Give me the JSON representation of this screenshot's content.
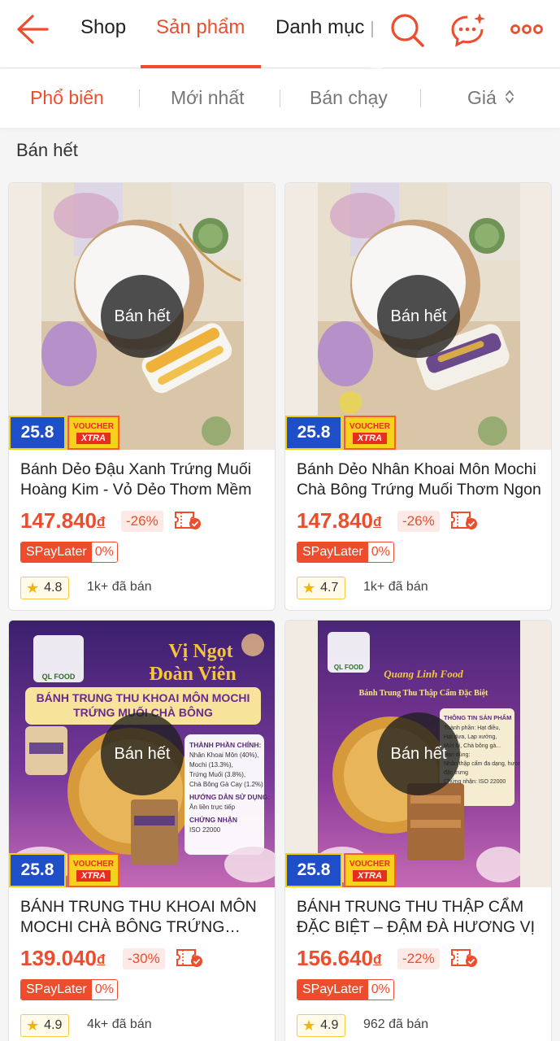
{
  "header": {
    "tabs": [
      {
        "label": "Shop"
      },
      {
        "label": "Sản phẩm"
      },
      {
        "label": "Danh mục"
      }
    ]
  },
  "sort": {
    "items": [
      {
        "label": "Phổ biến"
      },
      {
        "label": "Mới nhất"
      },
      {
        "label": "Bán chạy"
      },
      {
        "label": "Giá"
      }
    ]
  },
  "section": {
    "title": "Bán hết"
  },
  "colors": {
    "accent": "#ee4d2d"
  },
  "products": [
    {
      "name": "Bánh Dẻo Đậu Xanh Trứng Muối Hoàng Kim - Vỏ Dẻo Thơm Mềm",
      "price": "147.840",
      "currency": "đ",
      "discount": "-26%",
      "soldout": "Bán hết",
      "badge_event": "25.8",
      "badge_voucher_top": "VOUCHER",
      "badge_voucher_bottom": "XTRA",
      "spaylater": "SPayLater",
      "spaylater_rate": "0%",
      "rating": "4.8",
      "sold": "1k+ đã bán"
    },
    {
      "name": "Bánh Dẻo Nhân Khoai Môn Mochi Chà Bông Trứng Muối Thơm Ngon",
      "price": "147.840",
      "currency": "đ",
      "discount": "-26%",
      "soldout": "Bán hết",
      "badge_event": "25.8",
      "badge_voucher_top": "VOUCHER",
      "badge_voucher_bottom": "XTRA",
      "spaylater": "SPayLater",
      "spaylater_rate": "0%",
      "rating": "4.7",
      "sold": "1k+ đã bán"
    },
    {
      "name": "BÁNH TRUNG THU KHOAI MÔN MOCHI CHÀ BÔNG TRỨNG MUỐI",
      "price": "139.040",
      "currency": "đ",
      "discount": "-30%",
      "soldout": "Bán hết",
      "badge_event": "25.8",
      "badge_voucher_top": "VOUCHER",
      "badge_voucher_bottom": "XTRA",
      "spaylater": "SPayLater",
      "spaylater_rate": "0%",
      "rating": "4.9",
      "sold": "4k+ đã bán",
      "poster": {
        "logo": "QL FOOD",
        "headline_1": "Vị Ngọt",
        "headline_2": "Đoàn Viên",
        "banner_1": "BÁNH TRUNG THU KHOAI MÔN MOCHI",
        "banner_2": "TRỨNG MUỐI CHÀ BÔNG",
        "info_1": "THÀNH PHẦN CHÍNH:",
        "info_2": "Nhân Khoai Môn (40%),",
        "info_3": "Mochi (13.3%),",
        "info_4": "Trứng Muối (3.8%),",
        "info_5": "Chà Bông Gà Cay (1.2%)",
        "info_6": "HƯỚNG DẪN SỬ DỤNG:",
        "info_7": "Ăn liền trực tiếp",
        "info_8": "CHỨNG NHẬN",
        "info_9": "ISO 22000"
      }
    },
    {
      "name": "BÁNH TRUNG THU THẬP CẨM ĐẶC BIỆT – ĐẬM ĐÀ HƯƠNG VỊ",
      "price": "156.640",
      "currency": "đ",
      "discount": "-22%",
      "soldout": "Bán hết",
      "badge_event": "25.8",
      "badge_voucher_top": "VOUCHER",
      "badge_voucher_bottom": "XTRA",
      "spaylater": "SPayLater",
      "spaylater_rate": "0%",
      "rating": "4.9",
      "sold": "962 đã bán",
      "poster": {
        "logo": "QL FOOD",
        "brand": "Quang Linh Food",
        "subtitle": "Bánh Trung Thu Thập Cẩm Đặc Biệt",
        "info_1": "THÔNG TIN SẢN PHẨM",
        "info_2": "Thành phần: Hạt điều,",
        "info_3": "Hạt dưa, Lạp xưởng,",
        "info_4": "Mứt bí, Chà bông gà...",
        "info_5": "Hạn dùng:",
        "info_6": "Nhân thập cẩm đa dạng, hương vị",
        "info_7": "đặc trưng",
        "info_8": "Chứng nhận: ISO 22000"
      }
    }
  ]
}
